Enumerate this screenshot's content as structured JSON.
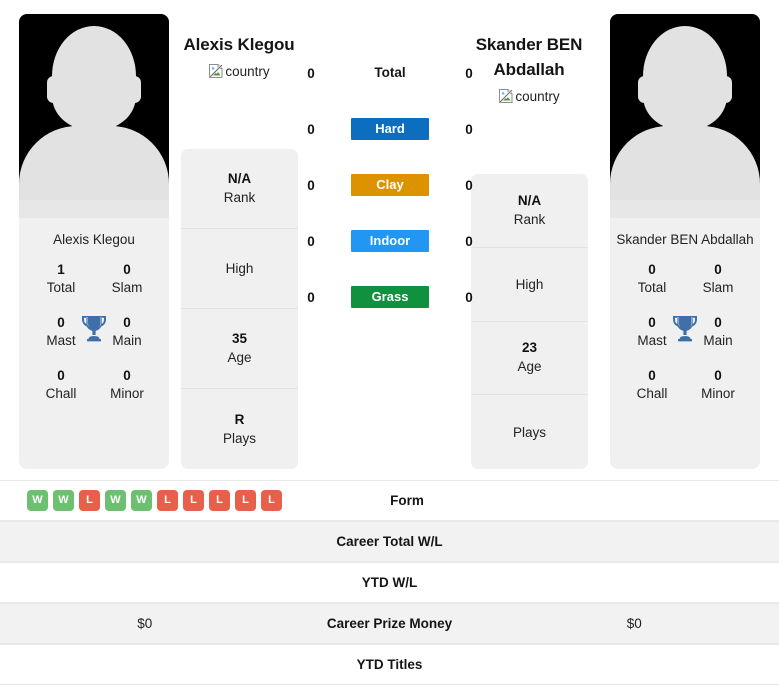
{
  "players": {
    "left": {
      "name": "Alexis Klegou",
      "photo_caption": "Alexis Klegou",
      "flag_alt": "country",
      "mini_stats": [
        {
          "value": "1",
          "label": "Total"
        },
        {
          "value": "0",
          "label": "Slam"
        },
        {
          "value": "0",
          "label": "Mast"
        },
        {
          "value": "0",
          "label": "Main"
        },
        {
          "value": "0",
          "label": "Chall"
        },
        {
          "value": "0",
          "label": "Minor"
        }
      ],
      "info": [
        {
          "value": "N/A",
          "label": "Rank"
        },
        {
          "value": "",
          "label": "High"
        },
        {
          "value": "35",
          "label": "Age"
        },
        {
          "value": "R",
          "label": "Plays"
        }
      ],
      "career_prize_money": "$0",
      "career_total_wl": "",
      "ytd_wl": "",
      "ytd_titles": "",
      "form": [
        {
          "result": "W"
        },
        {
          "result": "W"
        },
        {
          "result": "L"
        },
        {
          "result": "W"
        },
        {
          "result": "W"
        },
        {
          "result": "L"
        },
        {
          "result": "L"
        },
        {
          "result": "L"
        },
        {
          "result": "L"
        },
        {
          "result": "L"
        }
      ]
    },
    "right": {
      "name": "Skander BEN Abdallah",
      "photo_caption": "Skander BEN Abdallah",
      "flag_alt": "country",
      "mini_stats": [
        {
          "value": "0",
          "label": "Total"
        },
        {
          "value": "0",
          "label": "Slam"
        },
        {
          "value": "0",
          "label": "Mast"
        },
        {
          "value": "0",
          "label": "Main"
        },
        {
          "value": "0",
          "label": "Chall"
        },
        {
          "value": "0",
          "label": "Minor"
        }
      ],
      "info": [
        {
          "value": "N/A",
          "label": "Rank"
        },
        {
          "value": "",
          "label": "High"
        },
        {
          "value": "23",
          "label": "Age"
        },
        {
          "value": "",
          "label": "Plays"
        }
      ],
      "career_prize_money": "$0",
      "career_total_wl": "",
      "ytd_wl": "",
      "ytd_titles": "",
      "form": []
    }
  },
  "surfaces": [
    {
      "label": "Total",
      "left_value": "0",
      "right_value": "0",
      "color": ""
    },
    {
      "label": "Hard",
      "left_value": "0",
      "right_value": "0",
      "color": "#0d6ec0"
    },
    {
      "label": "Clay",
      "left_value": "0",
      "right_value": "0",
      "color": "#dd9200"
    },
    {
      "label": "Indoor",
      "left_value": "0",
      "right_value": "0",
      "color": "#2196f3"
    },
    {
      "label": "Grass",
      "left_value": "0",
      "right_value": "0",
      "color": "#119140"
    }
  ],
  "table_rows": [
    {
      "label": "Form",
      "left": "",
      "right": "",
      "alt": false,
      "form": true
    },
    {
      "label": "Career Total W/L",
      "left": "",
      "right": "",
      "alt": true,
      "form": false
    },
    {
      "label": "YTD W/L",
      "left": "",
      "right": "",
      "alt": false,
      "form": false
    },
    {
      "label": "Career Prize Money",
      "left": "$0",
      "right": "$0",
      "alt": true,
      "form": false
    },
    {
      "label": "YTD Titles",
      "left": "",
      "right": "",
      "alt": false,
      "form": false
    }
  ],
  "colors": {
    "win": "#6cc070",
    "loss": "#e8604c",
    "trophy": "#3f6fa8",
    "card_bg": "#f0f0f0",
    "alt_row": "#f2f2f2"
  }
}
